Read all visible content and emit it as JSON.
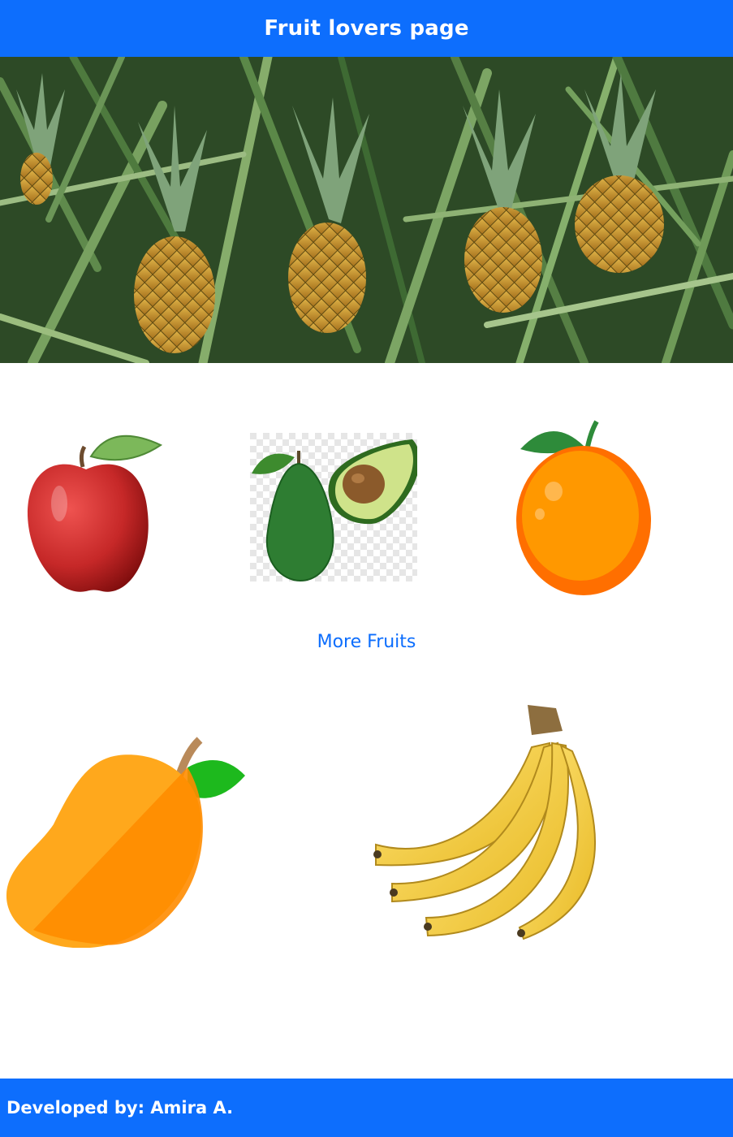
{
  "header": {
    "title": "Fruit lovers page"
  },
  "hero": {
    "image": "pineapple-field-photo"
  },
  "row1": {
    "images": [
      "apple",
      "avocado",
      "orange"
    ]
  },
  "link": {
    "label": "More Fruits"
  },
  "row2": {
    "images": [
      "mango",
      "banana"
    ]
  },
  "footer": {
    "text": "Developed by: Amira A."
  },
  "colors": {
    "primary": "#0d6efd",
    "background": "#ffffff",
    "text_on_primary": "#ffffff"
  }
}
